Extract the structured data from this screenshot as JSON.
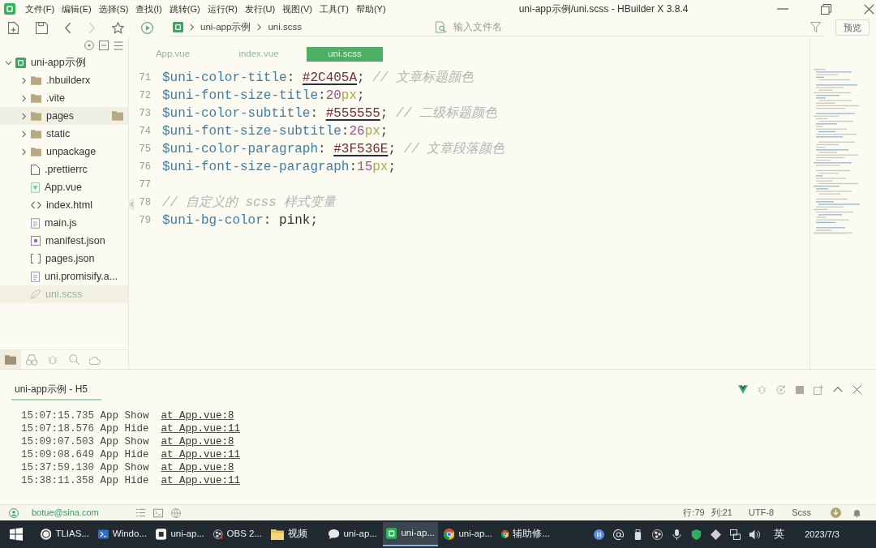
{
  "window": {
    "title": "uni-app示例/uni.scss - HBuilder X 3.8.4"
  },
  "menu": [
    "文件(F)",
    "编辑(E)",
    "选择(S)",
    "查找(I)",
    "跳转(G)",
    "运行(R)",
    "发行(U)",
    "视图(V)",
    "工具(T)",
    "帮助(Y)"
  ],
  "toolbar": [
    {
      "kind": "new-file",
      "disabled": false
    },
    {
      "kind": "save",
      "disabled": false
    },
    {
      "kind": "back",
      "disabled": false
    },
    {
      "kind": "forward",
      "disabled": true
    },
    {
      "kind": "star",
      "disabled": false
    },
    {
      "kind": "run",
      "disabled": false
    }
  ],
  "breadcrumb": [
    "uni-app示例",
    "uni.scss"
  ],
  "file_search": {
    "placeholder": "输入文件名"
  },
  "preview_button": "预览",
  "project_tree": [
    {
      "label": "uni-app示例",
      "kind": "project",
      "expanded": true,
      "selected": false,
      "hovered": false,
      "children": [
        {
          "label": ".hbuilderx",
          "kind": "folder",
          "expanded": false,
          "selected": false,
          "hovered": false
        },
        {
          "label": ".vite",
          "kind": "folder",
          "expanded": false,
          "selected": false,
          "hovered": false
        },
        {
          "label": "pages",
          "kind": "folder",
          "expanded": false,
          "selected": false,
          "hovered": true
        },
        {
          "label": "static",
          "kind": "folder",
          "expanded": false,
          "selected": false,
          "hovered": false
        },
        {
          "label": "unpackage",
          "kind": "folder",
          "expanded": false,
          "selected": false,
          "hovered": false
        },
        {
          "label": ".prettierrc",
          "kind": "blank",
          "selected": false,
          "hovered": false
        },
        {
          "label": "App.vue",
          "kind": "vue",
          "selected": false,
          "hovered": false
        },
        {
          "label": "index.html",
          "kind": "html",
          "selected": false,
          "hovered": false
        },
        {
          "label": "main.js",
          "kind": "js",
          "selected": false,
          "hovered": false
        },
        {
          "label": "manifest.json",
          "kind": "manifest",
          "selected": false,
          "hovered": false
        },
        {
          "label": "pages.json",
          "kind": "brackets",
          "selected": false,
          "hovered": false
        },
        {
          "label": "uni.promisify.a...",
          "kind": "js",
          "selected": false,
          "hovered": false
        },
        {
          "label": "uni.scss",
          "kind": "scss",
          "selected": true,
          "hovered": false
        }
      ]
    }
  ],
  "sidebar_tabs": [
    {
      "kind": "files",
      "selected": true
    },
    {
      "kind": "binoculars",
      "selected": false
    },
    {
      "kind": "bug",
      "selected": false
    },
    {
      "kind": "search",
      "selected": false
    },
    {
      "kind": "cloud",
      "selected": false
    }
  ],
  "editor": {
    "tabs": [
      {
        "label": "App.vue",
        "selected": false
      },
      {
        "label": "index.vue",
        "selected": false
      },
      {
        "label": "uni.scss",
        "selected": true
      }
    ],
    "lines": [
      {
        "number": "71",
        "tokens": [
          {
            "kind": "variable",
            "text": "$uni-color-title"
          },
          {
            "kind": "punct",
            "text": ": "
          },
          {
            "kind": "hex",
            "text": "#2C405A"
          },
          {
            "kind": "punct",
            "text": "; "
          },
          {
            "kind": "comment",
            "text": "// 文章标题颜色"
          }
        ]
      },
      {
        "number": "72",
        "tokens": [
          {
            "kind": "variable",
            "text": "$uni-font-size-title"
          },
          {
            "kind": "punct",
            "text": ":"
          },
          {
            "kind": "number",
            "text": "20"
          },
          {
            "kind": "unit",
            "text": "px"
          },
          {
            "kind": "punct",
            "text": ";"
          }
        ]
      },
      {
        "number": "73",
        "tokens": [
          {
            "kind": "variable",
            "text": "$uni-color-subtitle"
          },
          {
            "kind": "punct",
            "text": ": "
          },
          {
            "kind": "hex",
            "text": "#555555"
          },
          {
            "kind": "punct",
            "text": "; "
          },
          {
            "kind": "comment",
            "text": "// 二级标题颜色"
          }
        ]
      },
      {
        "number": "74",
        "tokens": [
          {
            "kind": "variable",
            "text": "$uni-font-size-subtitle"
          },
          {
            "kind": "punct",
            "text": ":"
          },
          {
            "kind": "number",
            "text": "26"
          },
          {
            "kind": "unit",
            "text": "px"
          },
          {
            "kind": "punct",
            "text": ";"
          }
        ]
      },
      {
        "number": "75",
        "tokens": [
          {
            "kind": "variable",
            "text": "$uni-color-paragraph"
          },
          {
            "kind": "punct",
            "text": ": "
          },
          {
            "kind": "hex",
            "text": "#3F536E"
          },
          {
            "kind": "punct",
            "text": "; "
          },
          {
            "kind": "comment",
            "text": "// 文章段落颜色"
          }
        ]
      },
      {
        "number": "76",
        "tokens": [
          {
            "kind": "variable",
            "text": "$uni-font-size-paragraph"
          },
          {
            "kind": "punct",
            "text": ":"
          },
          {
            "kind": "number",
            "text": "15"
          },
          {
            "kind": "unit",
            "text": "px"
          },
          {
            "kind": "punct",
            "text": ";"
          }
        ]
      },
      {
        "number": "77"
      },
      {
        "number": "78",
        "tokens": [
          {
            "kind": "comment",
            "text": "// 自定义的 scss 样式变量"
          }
        ]
      },
      {
        "number": "79",
        "tokens": [
          {
            "kind": "variable",
            "text": "$uni-bg-color"
          },
          {
            "kind": "punct",
            "text": ": "
          },
          {
            "kind": "value",
            "text": "pink"
          },
          {
            "kind": "punct",
            "text": ";"
          }
        ]
      }
    ]
  },
  "console": {
    "tab": "uni-app示例 - H5",
    "lines": [
      {
        "time": "15:07:15.735",
        "message": "App Show",
        "source": "at App.vue:8"
      },
      {
        "time": "15:07:18.576",
        "message": "App Hide",
        "source": "at App.vue:11"
      },
      {
        "time": "15:09:07.503",
        "message": "App Show",
        "source": "at App.vue:8"
      },
      {
        "time": "15:09:08.649",
        "message": "App Hide",
        "source": "at App.vue:11"
      },
      {
        "time": "15:37:59.130",
        "message": "App Show",
        "source": "at App.vue:8"
      },
      {
        "time": "15:38:11.358",
        "message": "App Hide",
        "source": "at App.vue:11"
      }
    ]
  },
  "status_bar": {
    "account": "botue@sina.com",
    "line": "行:79",
    "column": "列:21",
    "encoding": "UTF-8",
    "language": "Scss"
  },
  "taskbar": {
    "items": [
      {
        "kind": "ring",
        "label": "TLIAS...",
        "selected": false
      },
      {
        "kind": "terminal",
        "label": "Windo...",
        "selected": false
      },
      {
        "kind": "tile",
        "label": "uni-ap...",
        "selected": false
      },
      {
        "kind": "obs",
        "label": "OBS 2...",
        "selected": false
      },
      {
        "kind": "folder",
        "label": "视频",
        "selected": false
      },
      {
        "kind": "chat",
        "label": "uni-ap...",
        "selected": false
      },
      {
        "kind": "hbuilder",
        "label": "uni-ap...",
        "selected": true
      },
      {
        "kind": "browser",
        "label": "uni-ap...",
        "selected": false
      },
      {
        "kind": "browser",
        "label": "辅助修...",
        "selected": false
      }
    ],
    "input_method": "英",
    "date": "2023/7/3"
  }
}
